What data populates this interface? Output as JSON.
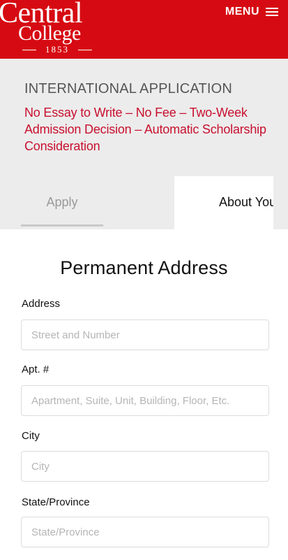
{
  "header": {
    "logo_line1": "Central",
    "logo_line2": "College",
    "logo_year": "1853",
    "menu_label": "MENU",
    "brand_color": "#d60a12"
  },
  "banner": {
    "title": "INTERNATIONAL APPLICATION",
    "subtitle": "No Essay to Write – No Fee – Two-Week Admission Decision – Automatic Scholarship Consideration"
  },
  "tabs": [
    {
      "label": "Apply",
      "active": false
    },
    {
      "label": "About You",
      "active": true
    }
  ],
  "form": {
    "section_title": "Permanent Address",
    "fields": [
      {
        "label": "Address",
        "value": "",
        "placeholder": "Street and Number"
      },
      {
        "label": "Apt. #",
        "value": "",
        "placeholder": "Apartment, Suite, Unit, Building, Floor, Etc."
      },
      {
        "label": "City",
        "value": "",
        "placeholder": "City"
      },
      {
        "label": "State/Province",
        "value": "",
        "placeholder": "State/Province"
      }
    ]
  }
}
